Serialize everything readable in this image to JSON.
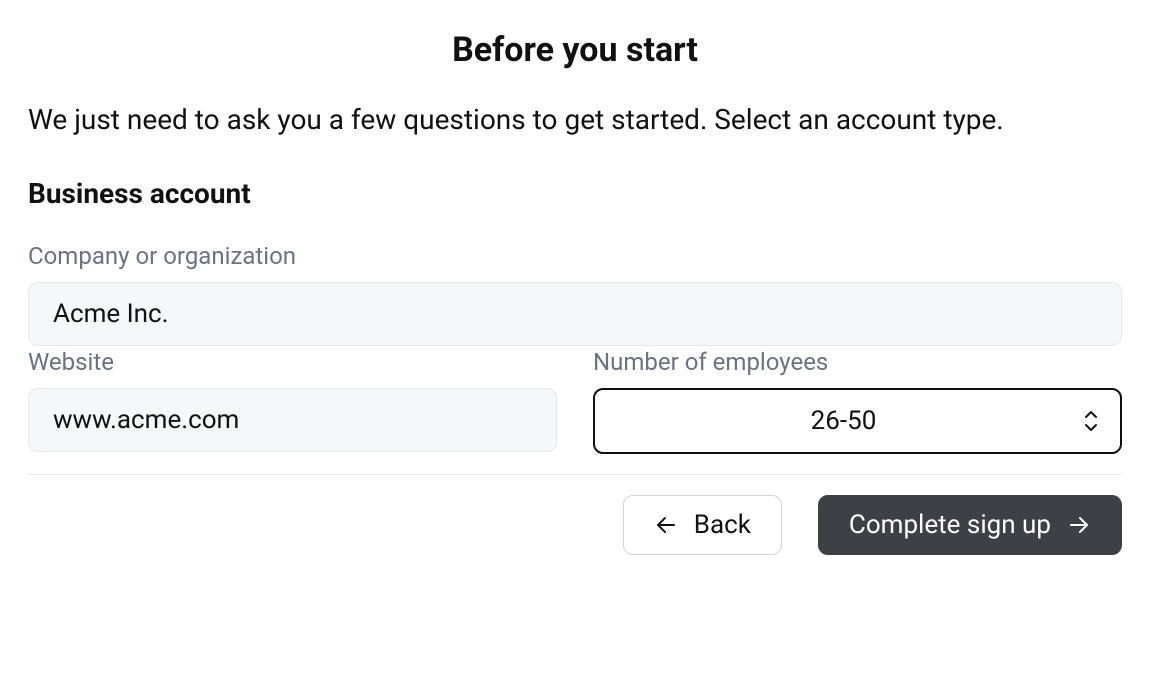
{
  "header": {
    "title": "Before you start",
    "intro": "We just need to ask you a few questions to get started. Select an account type."
  },
  "section": {
    "heading": "Business account"
  },
  "form": {
    "company": {
      "label": "Company or organization",
      "value": "Acme Inc."
    },
    "website": {
      "label": "Website",
      "value": "www.acme.com"
    },
    "employees": {
      "label": "Number of employees",
      "value": "26-50"
    }
  },
  "buttons": {
    "back": "Back",
    "complete": "Complete sign up"
  }
}
